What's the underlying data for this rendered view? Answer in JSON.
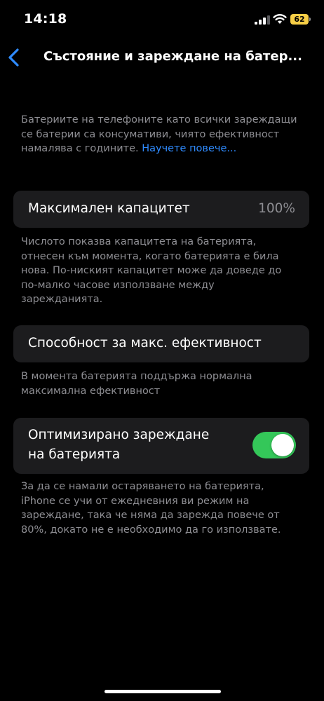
{
  "status_bar": {
    "time": "14:18",
    "battery_level": "62"
  },
  "nav": {
    "back_icon": "chevron-left-icon",
    "title": "Състояние и зареждане на батер..."
  },
  "intro": {
    "text": "Батериите на телефоните като всички зареждащи се батерии са консумативи, чиято ефективност намалява с годините. ",
    "link": "Научете повече..."
  },
  "max_capacity": {
    "label": "Максимален капацитет",
    "value": "100%",
    "note": "Числото показва капацитета на батерията, отнесен към момента, когато батерията е била нова. По-ниският капацитет може да доведе до по-малко часове използване между зарежданията."
  },
  "peak_performance": {
    "label": "Способност за макс. ефективност",
    "note": "В момента батерията поддържа нормална максимална ефективност"
  },
  "optimized_charging": {
    "label_line1": "Оптимизирано зареждане",
    "label_line2": "на батерията",
    "enabled": true,
    "note": "За да се намали остаряването на батерията, iPhone се учи от ежедневния ви режим на зареждане, така че няма да зарежда повече от 80%, докато не е необходимо да го използвате."
  },
  "colors": {
    "accent": "#2f8bff",
    "toggle_on": "#34c759",
    "battery": "#f7ce46",
    "card_bg": "#1c1c1e",
    "secondary_text": "#8e8e93"
  }
}
